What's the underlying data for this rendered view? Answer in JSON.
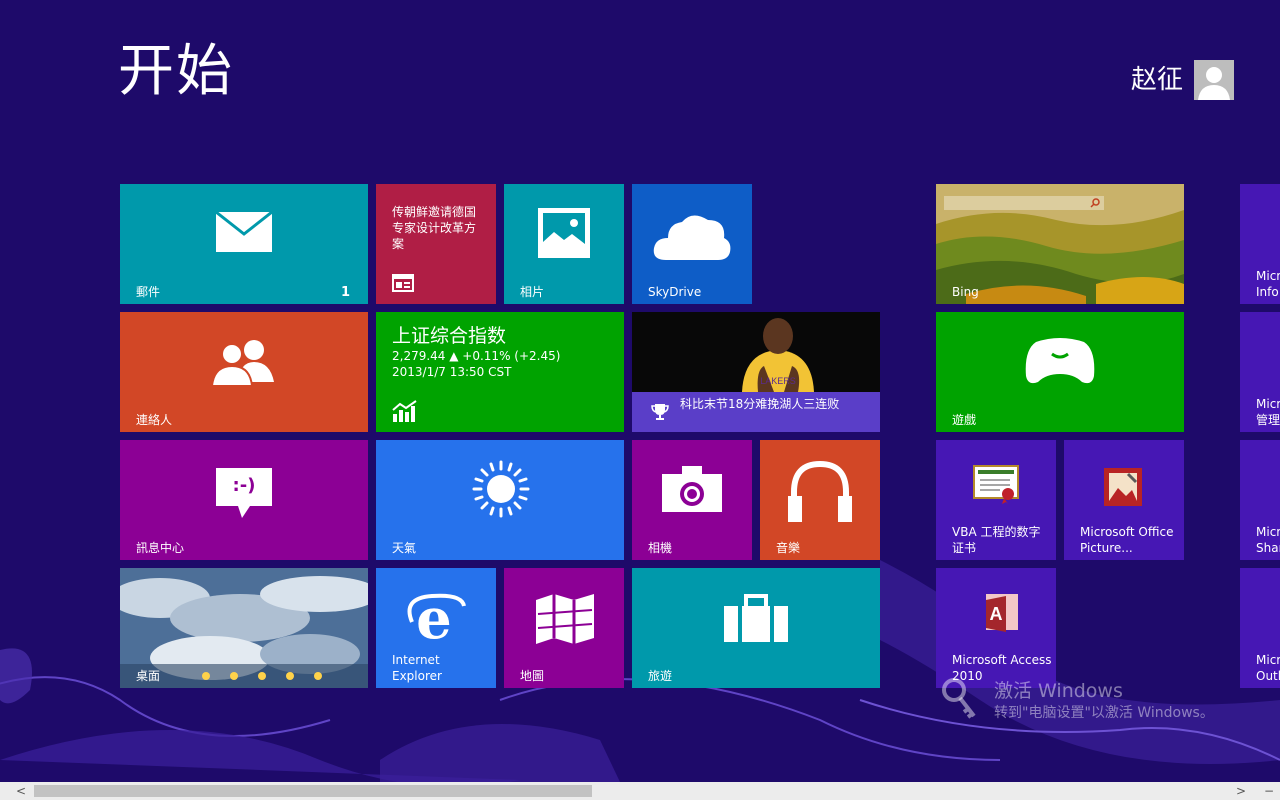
{
  "start": {
    "title": "开始"
  },
  "user": {
    "name": "赵征"
  },
  "tiles": {
    "mail": {
      "label": "郵件",
      "badge": "1",
      "color": "#0099ab"
    },
    "news": {
      "headline": "传朝鲜邀请德国专家设计改革方案",
      "color": "#b01e45"
    },
    "photos": {
      "label": "相片",
      "color": "#0099ab"
    },
    "skydrive": {
      "label": "SkyDrive",
      "color": "#0e5dc7"
    },
    "bing": {
      "label": "Bing"
    },
    "people": {
      "label": "連絡人",
      "color": "#d24726"
    },
    "finance": {
      "title": "上证综合指数",
      "line1": "2,279.44 ▲ +0.11% (+2.45)",
      "line2": "2013/1/7 13:50 CST",
      "color": "#00a300"
    },
    "sports": {
      "headline": "科比末节18分难挽湖人三连败",
      "jersey": "LAKERS"
    },
    "games": {
      "label": "遊戲",
      "color": "#00a300"
    },
    "messaging": {
      "label": "訊息中心",
      "glyph": ":-)",
      "color": "#8c0095"
    },
    "weather": {
      "label": "天氣",
      "color": "#2672ec"
    },
    "camera": {
      "label": "相機",
      "color": "#8c0095"
    },
    "music": {
      "label": "音樂",
      "color": "#d24726"
    },
    "vba": {
      "label": "VBA 工程的数字证书",
      "color": "#4617b4"
    },
    "picture_manager": {
      "label": "Microsoft Office Picture...",
      "color": "#4617b4"
    },
    "desktop": {
      "label": "桌面"
    },
    "ie": {
      "label": "Internet Explorer",
      "color": "#2672ec"
    },
    "maps": {
      "label": "地圖",
      "color": "#8c0095"
    },
    "travel": {
      "label": "旅遊",
      "color": "#0099ab"
    },
    "access": {
      "label": "Microsoft Access 2010",
      "color": "#4617b4"
    },
    "partial": [
      {
        "label": "Micr Info"
      },
      {
        "label": "Micr 管理"
      },
      {
        "label": "Micr Shar"
      },
      {
        "label": "Micr Outl"
      }
    ]
  },
  "activation": {
    "title": "激活 Windows",
    "subtitle": "转到\"电脑设置\"以激活 Windows。"
  },
  "scrollbar": {
    "left": "<",
    "right": ">",
    "minimize": "−"
  }
}
